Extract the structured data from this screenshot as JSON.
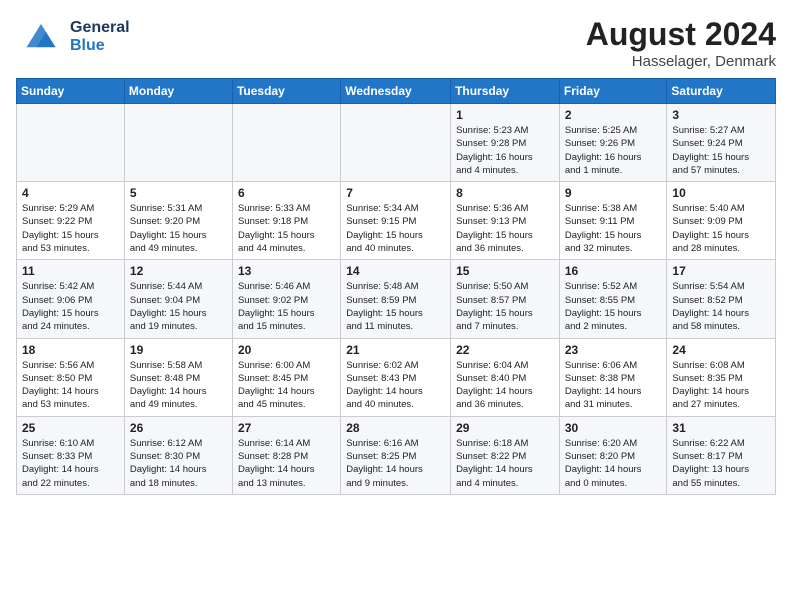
{
  "header": {
    "logo_general": "General",
    "logo_blue": "Blue",
    "month_year": "August 2024",
    "location": "Hasselager, Denmark"
  },
  "days_of_week": [
    "Sunday",
    "Monday",
    "Tuesday",
    "Wednesday",
    "Thursday",
    "Friday",
    "Saturday"
  ],
  "weeks": [
    [
      {
        "day": "",
        "info": ""
      },
      {
        "day": "",
        "info": ""
      },
      {
        "day": "",
        "info": ""
      },
      {
        "day": "",
        "info": ""
      },
      {
        "day": "1",
        "info": "Sunrise: 5:23 AM\nSunset: 9:28 PM\nDaylight: 16 hours\nand 4 minutes."
      },
      {
        "day": "2",
        "info": "Sunrise: 5:25 AM\nSunset: 9:26 PM\nDaylight: 16 hours\nand 1 minute."
      },
      {
        "day": "3",
        "info": "Sunrise: 5:27 AM\nSunset: 9:24 PM\nDaylight: 15 hours\nand 57 minutes."
      }
    ],
    [
      {
        "day": "4",
        "info": "Sunrise: 5:29 AM\nSunset: 9:22 PM\nDaylight: 15 hours\nand 53 minutes."
      },
      {
        "day": "5",
        "info": "Sunrise: 5:31 AM\nSunset: 9:20 PM\nDaylight: 15 hours\nand 49 minutes."
      },
      {
        "day": "6",
        "info": "Sunrise: 5:33 AM\nSunset: 9:18 PM\nDaylight: 15 hours\nand 44 minutes."
      },
      {
        "day": "7",
        "info": "Sunrise: 5:34 AM\nSunset: 9:15 PM\nDaylight: 15 hours\nand 40 minutes."
      },
      {
        "day": "8",
        "info": "Sunrise: 5:36 AM\nSunset: 9:13 PM\nDaylight: 15 hours\nand 36 minutes."
      },
      {
        "day": "9",
        "info": "Sunrise: 5:38 AM\nSunset: 9:11 PM\nDaylight: 15 hours\nand 32 minutes."
      },
      {
        "day": "10",
        "info": "Sunrise: 5:40 AM\nSunset: 9:09 PM\nDaylight: 15 hours\nand 28 minutes."
      }
    ],
    [
      {
        "day": "11",
        "info": "Sunrise: 5:42 AM\nSunset: 9:06 PM\nDaylight: 15 hours\nand 24 minutes."
      },
      {
        "day": "12",
        "info": "Sunrise: 5:44 AM\nSunset: 9:04 PM\nDaylight: 15 hours\nand 19 minutes."
      },
      {
        "day": "13",
        "info": "Sunrise: 5:46 AM\nSunset: 9:02 PM\nDaylight: 15 hours\nand 15 minutes."
      },
      {
        "day": "14",
        "info": "Sunrise: 5:48 AM\nSunset: 8:59 PM\nDaylight: 15 hours\nand 11 minutes."
      },
      {
        "day": "15",
        "info": "Sunrise: 5:50 AM\nSunset: 8:57 PM\nDaylight: 15 hours\nand 7 minutes."
      },
      {
        "day": "16",
        "info": "Sunrise: 5:52 AM\nSunset: 8:55 PM\nDaylight: 15 hours\nand 2 minutes."
      },
      {
        "day": "17",
        "info": "Sunrise: 5:54 AM\nSunset: 8:52 PM\nDaylight: 14 hours\nand 58 minutes."
      }
    ],
    [
      {
        "day": "18",
        "info": "Sunrise: 5:56 AM\nSunset: 8:50 PM\nDaylight: 14 hours\nand 53 minutes."
      },
      {
        "day": "19",
        "info": "Sunrise: 5:58 AM\nSunset: 8:48 PM\nDaylight: 14 hours\nand 49 minutes."
      },
      {
        "day": "20",
        "info": "Sunrise: 6:00 AM\nSunset: 8:45 PM\nDaylight: 14 hours\nand 45 minutes."
      },
      {
        "day": "21",
        "info": "Sunrise: 6:02 AM\nSunset: 8:43 PM\nDaylight: 14 hours\nand 40 minutes."
      },
      {
        "day": "22",
        "info": "Sunrise: 6:04 AM\nSunset: 8:40 PM\nDaylight: 14 hours\nand 36 minutes."
      },
      {
        "day": "23",
        "info": "Sunrise: 6:06 AM\nSunset: 8:38 PM\nDaylight: 14 hours\nand 31 minutes."
      },
      {
        "day": "24",
        "info": "Sunrise: 6:08 AM\nSunset: 8:35 PM\nDaylight: 14 hours\nand 27 minutes."
      }
    ],
    [
      {
        "day": "25",
        "info": "Sunrise: 6:10 AM\nSunset: 8:33 PM\nDaylight: 14 hours\nand 22 minutes."
      },
      {
        "day": "26",
        "info": "Sunrise: 6:12 AM\nSunset: 8:30 PM\nDaylight: 14 hours\nand 18 minutes."
      },
      {
        "day": "27",
        "info": "Sunrise: 6:14 AM\nSunset: 8:28 PM\nDaylight: 14 hours\nand 13 minutes."
      },
      {
        "day": "28",
        "info": "Sunrise: 6:16 AM\nSunset: 8:25 PM\nDaylight: 14 hours\nand 9 minutes."
      },
      {
        "day": "29",
        "info": "Sunrise: 6:18 AM\nSunset: 8:22 PM\nDaylight: 14 hours\nand 4 minutes."
      },
      {
        "day": "30",
        "info": "Sunrise: 6:20 AM\nSunset: 8:20 PM\nDaylight: 14 hours\nand 0 minutes."
      },
      {
        "day": "31",
        "info": "Sunrise: 6:22 AM\nSunset: 8:17 PM\nDaylight: 13 hours\nand 55 minutes."
      }
    ]
  ]
}
